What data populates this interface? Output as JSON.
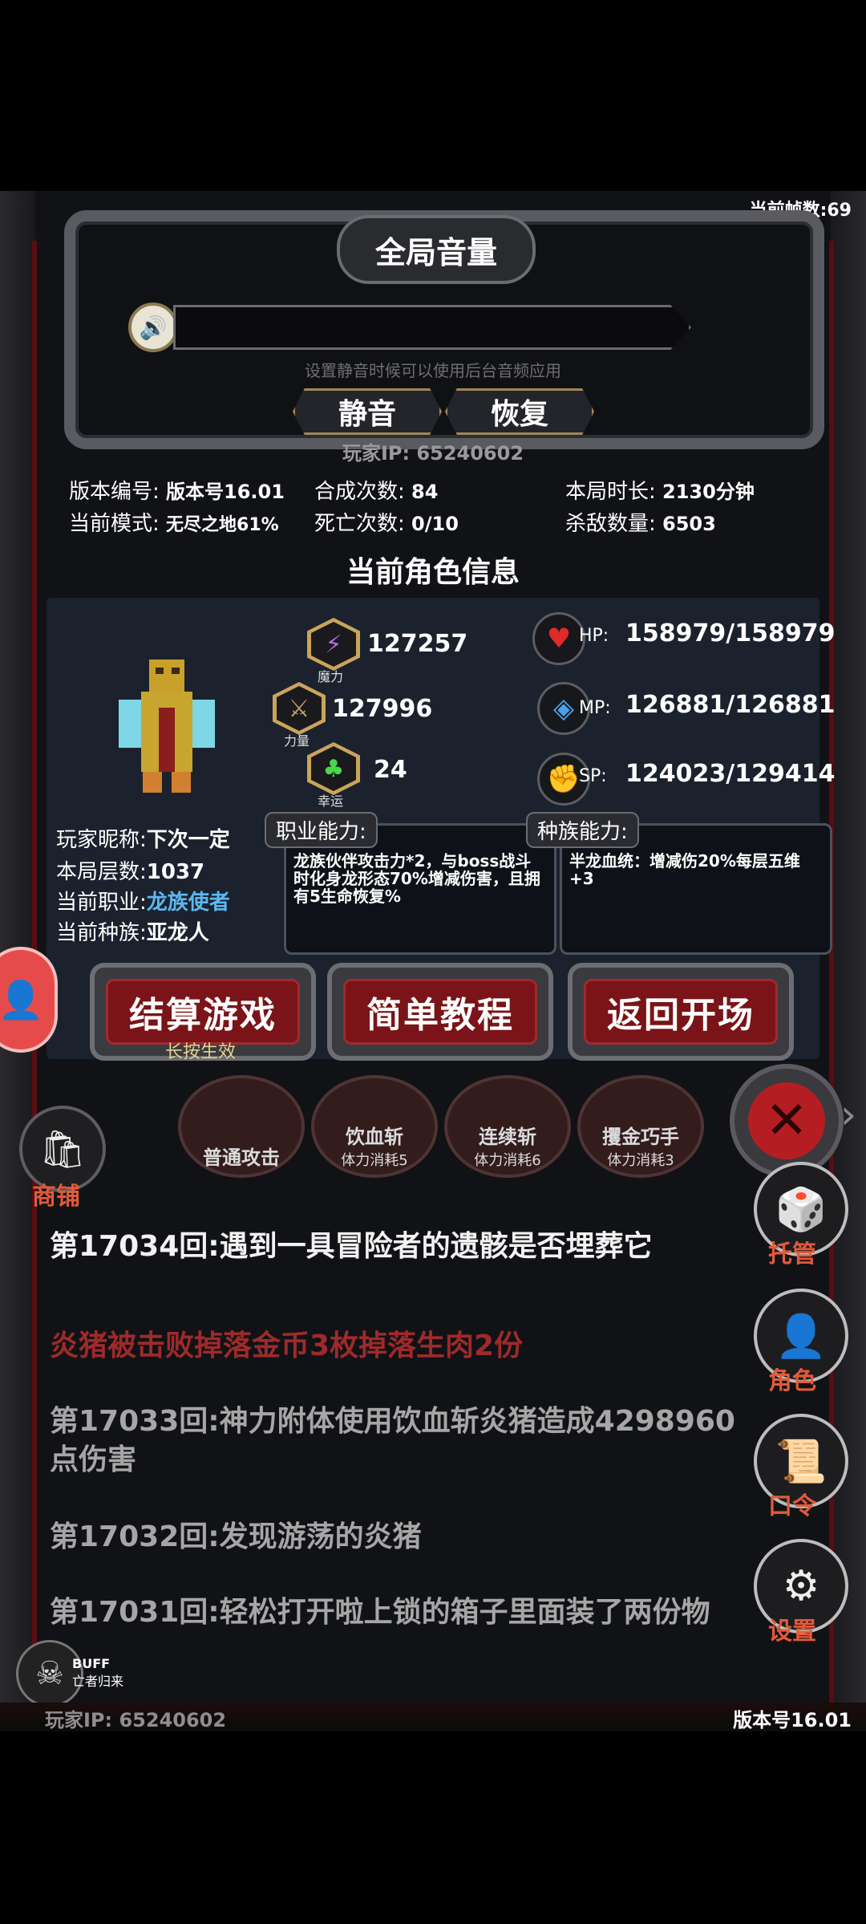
{
  "fps": "当前帧数:69",
  "volume": {
    "title": "全局音量",
    "hint": "设置静音时候可以使用后台音频应用",
    "mute_label": "静音",
    "restore_label": "恢复",
    "speaker_icon": "speaker-icon"
  },
  "player_ip_top": "玩家IP:  65240602",
  "stats": {
    "version_label": "版本编号:",
    "version_value": "版本号16.01",
    "mode_label": "当前模式:",
    "mode_value": "无尽之地61%",
    "synth_label": "合成次数:",
    "synth_value": "84",
    "death_label": "死亡次数:",
    "death_value": "0/10",
    "duration_label": "本局时长:",
    "duration_value": "2130分钟",
    "kills_label": "杀敌数量:",
    "kills_value": "6503"
  },
  "character": {
    "section_title": "当前角色信息",
    "magic_label": "魔力",
    "magic_value": "127257",
    "strength_label": "力量",
    "strength_value": "127996",
    "luck_label": "幸运",
    "luck_value": "24",
    "hp_label": "HP:",
    "hp_value": "158979/158979",
    "mp_label": "MP:",
    "mp_value": "126881/126881",
    "sp_label": "SP:",
    "sp_value": "124023/129414",
    "nickname_label": "玩家昵称:",
    "nickname_value": "下次一定",
    "floor_label": "本局层数:",
    "floor_value": "1037",
    "job_label": "当前职业:",
    "job_value": "龙族使者",
    "race_label": "当前种族:",
    "race_value": "亚龙人",
    "job_ability_tag": "职业能力:",
    "job_ability_text": "龙族伙伴攻击力*2，与boss战斗时化身龙形态70%增减伤害，且拥有5生命恢复%",
    "race_ability_tag": "种族能力:",
    "race_ability_text": "半龙血统：增减伤20%每层五维+3",
    "accent_job_color": "#5bb8f0"
  },
  "buttons": {
    "settle": "结算游戏",
    "settle_note": "长按生效",
    "tutorial": "简单教程",
    "back": "返回开场"
  },
  "skills": [
    {
      "name": "普通攻击",
      "cost": ""
    },
    {
      "name": "饮血斩",
      "cost": "体力消耗5"
    },
    {
      "name": "连续斩",
      "cost": "体力消耗6"
    },
    {
      "name": "攫金巧手",
      "cost": "体力消耗3"
    }
  ],
  "shop_label": "商铺",
  "side_buttons": {
    "auto": "托管",
    "role": "角色",
    "code": "口令",
    "settings": "设置"
  },
  "log": [
    "第17034回:遇到一具冒险者的遗骸是否埋葬它",
    "炎猪被击败掉落金币3枚掉落生肉2份",
    "第17033回:神力附体使用饮血斩炎猪造成4298960点伤害",
    "第17032回:发现游荡的炎猪",
    "第17031回:轻松打开啦上锁的箱子里面装了两份物"
  ],
  "buff": {
    "title": "BUFF",
    "sub": "亡者归来"
  },
  "footer": {
    "ip": "玩家IP:  65240602",
    "version": "版本号16.01"
  }
}
